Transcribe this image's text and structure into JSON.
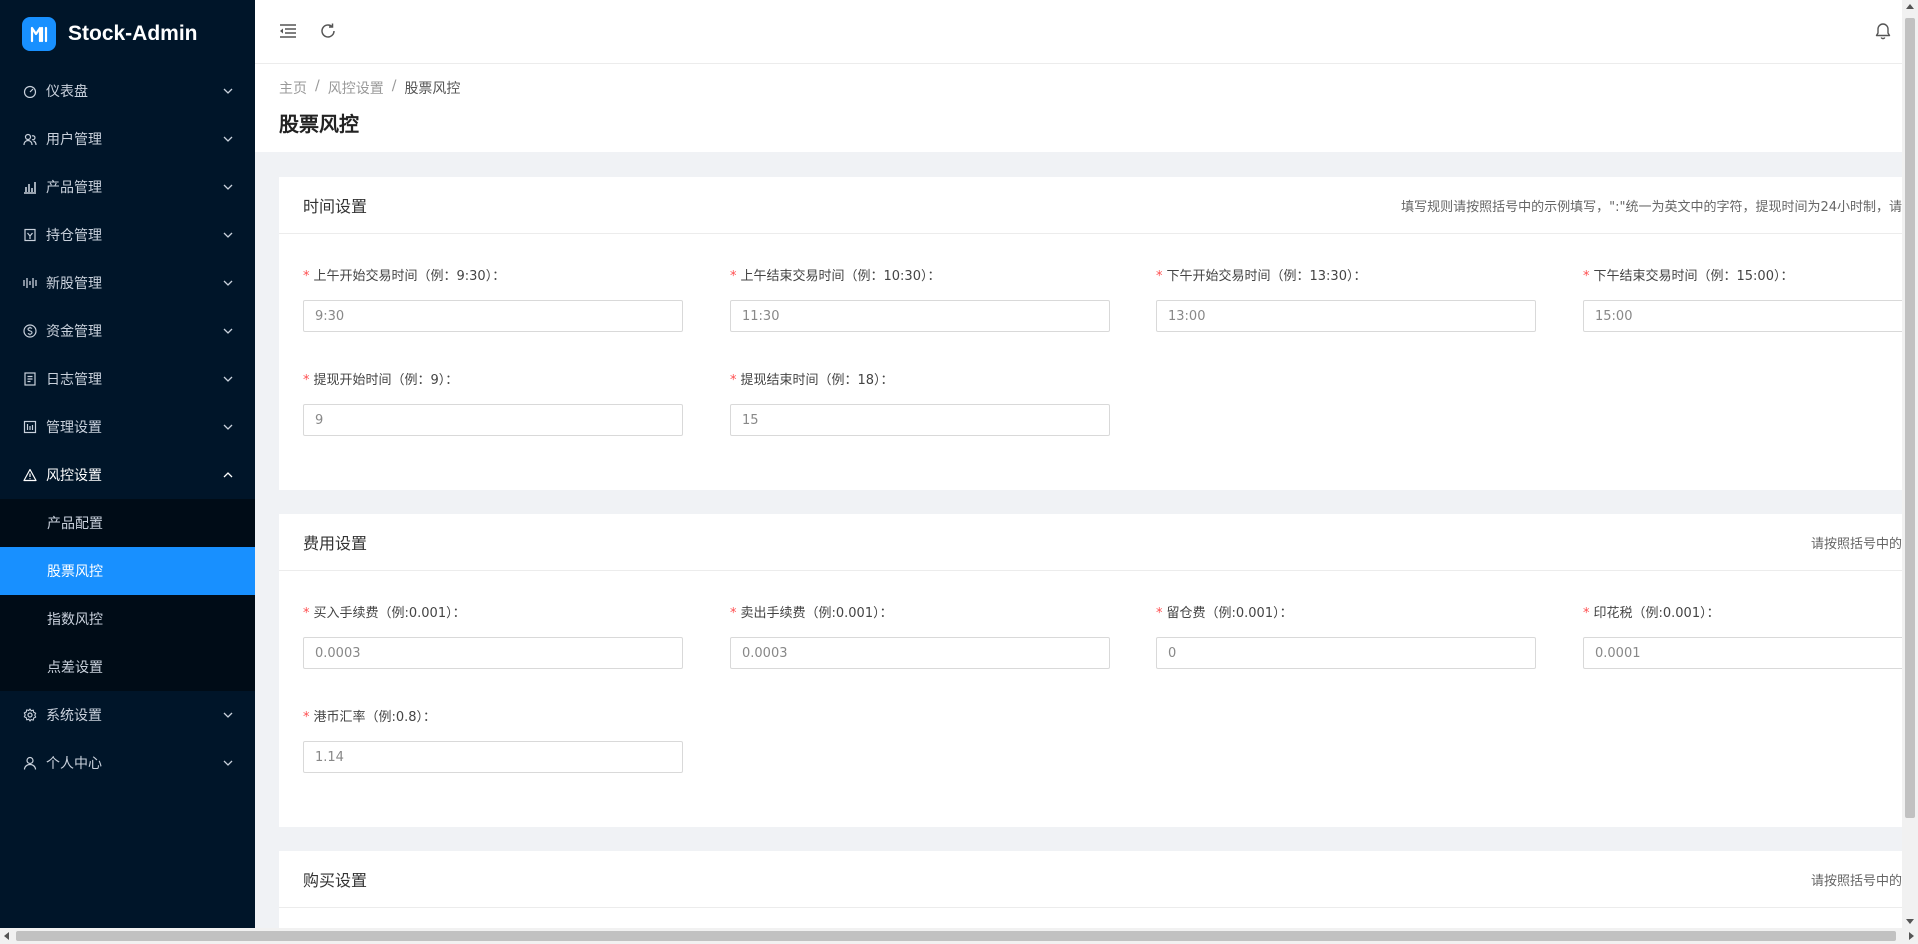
{
  "app": {
    "title": "Stock-Admin"
  },
  "colors": {
    "sidebar_bg": "#001529",
    "accent": "#1890ff",
    "required": "#ff4d4f"
  },
  "sidebar": {
    "items": [
      {
        "label": "仪表盘",
        "icon": "dashboard-icon"
      },
      {
        "label": "用户管理",
        "icon": "user-group-icon"
      },
      {
        "label": "产品管理",
        "icon": "bar-chart-icon"
      },
      {
        "label": "持仓管理",
        "icon": "position-icon"
      },
      {
        "label": "新股管理",
        "icon": "signal-icon"
      },
      {
        "label": "资金管理",
        "icon": "money-icon"
      },
      {
        "label": "日志管理",
        "icon": "log-icon"
      },
      {
        "label": "管理设置",
        "icon": "admin-settings-icon"
      },
      {
        "label": "风控设置",
        "icon": "warning-icon"
      },
      {
        "label": "系统设置",
        "icon": "gear-icon"
      },
      {
        "label": "个人中心",
        "icon": "person-icon"
      }
    ],
    "risk_sub": [
      "产品配置",
      "股票风控",
      "指数风控",
      "点差设置"
    ]
  },
  "breadcrumb": [
    "主页",
    "风控设置",
    "股票风控"
  ],
  "page_title": "股票风控",
  "time_card": {
    "title": "时间设置",
    "hint": "填写规则请按照括号中的示例填写，\":\"统一为英文中的字符，提现时间为24小时制，请",
    "fields": [
      {
        "label": "上午开始交易时间（例：9:30）：",
        "value": "9:30"
      },
      {
        "label": "上午结束交易时间（例：10:30）：",
        "value": "11:30"
      },
      {
        "label": "下午开始交易时间（例：13:30）：",
        "value": "13:00"
      },
      {
        "label": "下午结束交易时间（例：15:00）：",
        "value": "15:00"
      },
      {
        "label": "提现开始时间（例：9）：",
        "value": "9"
      },
      {
        "label": "提现结束时间（例：18）：",
        "value": "15"
      }
    ]
  },
  "fee_card": {
    "title": "费用设置",
    "hint": "请按照括号中的",
    "fields": [
      {
        "label": "买入手续费（例:0.001）：",
        "value": "0.0003"
      },
      {
        "label": "卖出手续费（例:0.001）：",
        "value": "0.0003"
      },
      {
        "label": "留仓费（例:0.001）：",
        "value": "0"
      },
      {
        "label": "印花税（例:0.001）：",
        "value": "0.0001"
      },
      {
        "label": "港币汇率（例:0.8）：",
        "value": "1.14"
      }
    ]
  },
  "buy_card": {
    "title": "购买设置",
    "hint": "请按照括号中的"
  },
  "required_mark": "*"
}
